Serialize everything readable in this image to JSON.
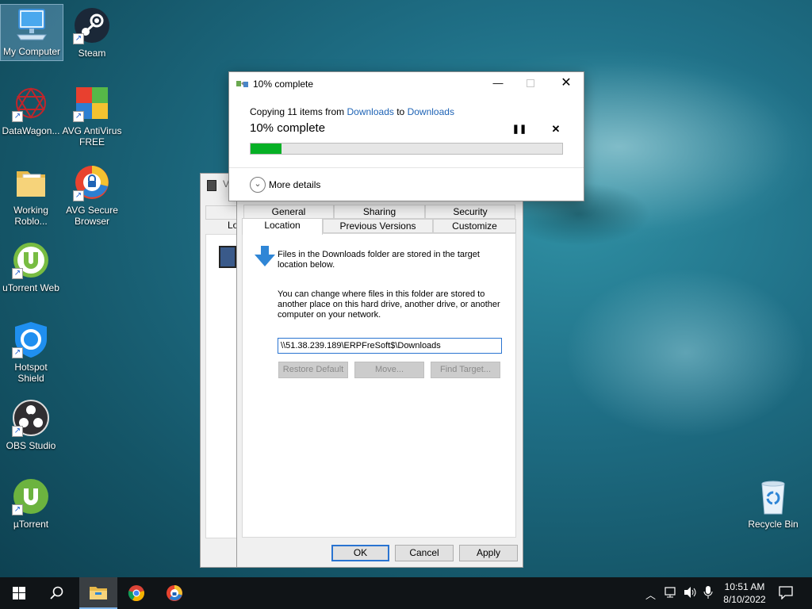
{
  "desktop": {
    "icons": [
      {
        "label": "My Computer",
        "icon": "computer-icon"
      },
      {
        "label": "Steam",
        "icon": "steam-icon"
      },
      {
        "label": "DataWagon...",
        "icon": "datawagon-icon"
      },
      {
        "label": "AVG AntiVirus FREE",
        "icon": "avg-antivirus-icon"
      },
      {
        "label": "Working Roblo...",
        "icon": "folder-icon"
      },
      {
        "label": "AVG Secure Browser",
        "icon": "avg-browser-icon"
      },
      {
        "label": "uTorrent Web",
        "icon": "utorrent-web-icon"
      },
      {
        "label": "Hotspot Shield",
        "icon": "hotspot-shield-icon"
      },
      {
        "label": "OBS Studio",
        "icon": "obs-icon"
      },
      {
        "label": "µTorrent",
        "icon": "utorrent-icon"
      },
      {
        "label": "Recycle Bin",
        "icon": "recycle-bin-icon"
      }
    ]
  },
  "copy_dialog": {
    "title": "10% complete",
    "copy_prefix": "Copying 11 items from",
    "source": "Downloads",
    "to_word": "to",
    "destination": "Downloads",
    "status": "10% complete",
    "progress": 0.1,
    "progress_color": "#06b025",
    "more_details": "More details"
  },
  "properties": {
    "back_title_fragment": "V",
    "back_tab_fragment": "Lo",
    "tabs_row1": [
      "General",
      "Sharing",
      "Security"
    ],
    "tabs_row2": [
      "Location",
      "Previous Versions",
      "Customize"
    ],
    "info_text": "Files in the Downloads folder are stored in the target location below.",
    "change_text": "You can change where files in this folder are stored to another place on this hard drive, another drive, or another computer on your network.",
    "path_value": "\\\\51.38.239.189\\ERPFreSoft$\\Downloads",
    "restore_default": "Restore Default",
    "move": "Move...",
    "find_target": "Find Target...",
    "ok": "OK",
    "cancel": "Cancel",
    "apply": "Apply"
  },
  "taskbar": {
    "time": "10:51 AM",
    "date": "8/10/2022"
  }
}
